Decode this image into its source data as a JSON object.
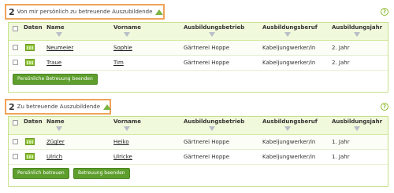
{
  "section1": {
    "count": "2",
    "title": "Von mir persönlich zu betreuende Auszubildende",
    "columns": [
      "Daten",
      "Name",
      "Vorname",
      "Ausbildungsbetrieb",
      "Ausbildungsberuf",
      "Ausbildungsjahr"
    ],
    "rows": [
      {
        "name": "Neumeier",
        "vorname": "Sophie",
        "betrieb": "Gärtnerei Hoppe",
        "beruf": "Kabeljungwerker/in",
        "jahr": "2. Jahr"
      },
      {
        "name": "Traue",
        "vorname": "Tim",
        "betrieb": "Gärtnerei Hoppe",
        "beruf": "Kabeljungwerker/in",
        "jahr": "2. Jahr"
      }
    ],
    "buttons": [
      "Persönliche Betreuung beenden"
    ]
  },
  "section2": {
    "count": "2",
    "title": "Zu betreuende Auszubildende",
    "columns": [
      "Daten",
      "Name",
      "Vorname",
      "Ausbildungsbetrieb",
      "Ausbildungsberuf",
      "Ausbildungsjahr"
    ],
    "rows": [
      {
        "name": "Zügler",
        "vorname": "Heiko",
        "betrieb": "Gärtnerei Hoppe",
        "beruf": "Kabeljungwerker/in",
        "jahr": "1. Jahr"
      },
      {
        "name": "Ulrich",
        "vorname": "Ulricke",
        "betrieb": "Gärtnerei Hoppe",
        "beruf": "Kabeljungwerker/in",
        "jahr": "1. Jahr"
      }
    ],
    "buttons": [
      "Persönlich betreuen",
      "Betreuung beenden"
    ]
  },
  "help_glyph": "?",
  "colors": {
    "accent_orange": "#f0a35a",
    "button_green": "#5e9e2d",
    "header_bg": "#f1f9dc"
  }
}
